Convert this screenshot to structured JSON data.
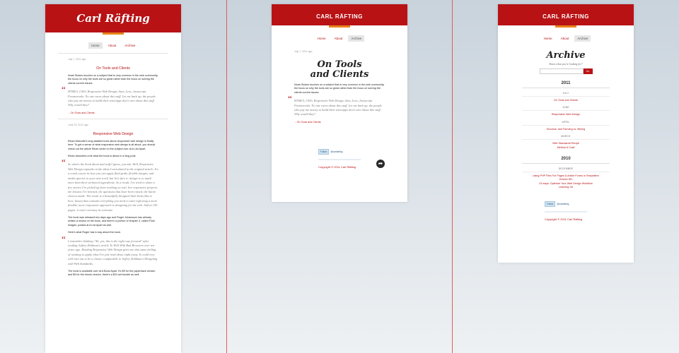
{
  "site_title": "Carl Räfting",
  "nav": {
    "home": "Home",
    "about": "About",
    "archive": "Archive"
  },
  "page1": {
    "post1": {
      "date": "July 7, 2011 ago",
      "title": "On Tools and Clients",
      "body": "Noah Stokes touches on a subject that is very common in the web community, the focus on why the tools are so great rather than the focus on solving the clients current issues.",
      "quote": "HTML5, CSS3, Responsive Web Design, Sass, Less, Javascript Frameworks. No one cares about this stuff. Let me back up, the people who pay me money to build their sites/apps don't care about this stuff. Why would they?",
      "link": "→On Tools and Clients"
    },
    "post2": {
      "date": "June 23, 2011 ago",
      "title": "Responsive Web Design",
      "body1": "Ethan Marcotte's long awaited book about responsive web design is finally here. To get a sense of what responsive web design is all about, you should check out the article Ethan wrote on the subject over at A List Apart.",
      "body2": "Ethan describes a bit what the book is about in a blog post:",
      "quote1": "So what's the book about and stuff I guess, you ask. Well, Responsive Web Design expands on the ideas I articulated in the original article. It's a crash course in how you can apply fluid grids, flexible images, and media queries to your next work, but let's face it: design is so much more than three technical ingredients. As a result, I've tried to share a few stories I've picked up from working on real, live responsive projects: the lessons I've learned, the questions that have been raised, the harsh choices made. The result is a beautifully designed little book (this is how, Jason) that contains everything you need to start exploring a more flexible, more responsive approach to designing for the web. And at 150 pages, it won't overstay its welcome.",
      "body3": "The book was released two days ago and Roger Johansson has already written a review on the book, and there's a portion of chapter 3, called Fluid Images, posted at A List Apart as well.",
      "body4": "Here's what Roger has to say about the book:",
      "quote2": "I remember thinking \"Ah, yes, this is the right way forward\" after reading Jeffrey Zeldman's article To Hell With Bad Browsers over ten years ago. Reading Responsive Web Design gives me that same feeling of wanting to apply what I've just read about right away. It could very well turn out to be a classic comparable to Jeffrey Zeldman's Designing with Web Standards.",
      "body5": "The book is available over at A Book Apart. It's $9 for the paperback version and $9 for the ebook version, there's a $24 set bundle as well."
    }
  },
  "page2": {
    "date": "July 7, 2011 ago",
    "title_line1": "On Tools",
    "title_line2": "and Clients",
    "body": "Noah Stokes touches on a subject that is very common in the web community, the focus on why the tools are so great rather than the focus on solving the clients current issues.",
    "quote": "HTML5, CSS3, Responsive Web Design, Sass, Less, Javascript Frameworks. No one cares about this stuff. Let me back up, the people who pay me money to build their sites/apps don't care about this stuff. Why would they?",
    "link": "→On Tools and Clients",
    "share_icon": "share-icon",
    "follow": "Follow",
    "handle": "@carlrafting",
    "copyright": "Copyright © 2011 Carl Räfting"
  },
  "page3": {
    "title": "Archive",
    "subtitle": "Know what you're looking for?",
    "go": "Go",
    "years": [
      {
        "year": "2011",
        "months": [
          {
            "name": "July",
            "links": [
              "On Tools and Clients"
            ]
          },
          {
            "name": "June",
            "links": [
              "Responsive Web Design"
            ]
          },
          {
            "name": "April",
            "links": [
              "Success, and Farming vs. Mining"
            ]
          },
          {
            "name": "March",
            "links": [
              "Web Standards Recipe",
              "Method & Craft"
            ]
          }
        ]
      },
      {
        "year": "2010",
        "months": [
          {
            "name": "December",
            "links": [
              "Using PHP Files For Pages & Article Forms in Textpattern",
              "Version 811",
              "24 ways: Optimize Your Web Design Workflow",
              "Learning Git"
            ]
          }
        ]
      }
    ],
    "follow": "Follow",
    "handle": "@carlrafting",
    "copyright": "Copyright © 2011 Carl Räfting"
  },
  "colors": {
    "brand_red": "#b81215",
    "accent_orange": "#e8861a"
  }
}
